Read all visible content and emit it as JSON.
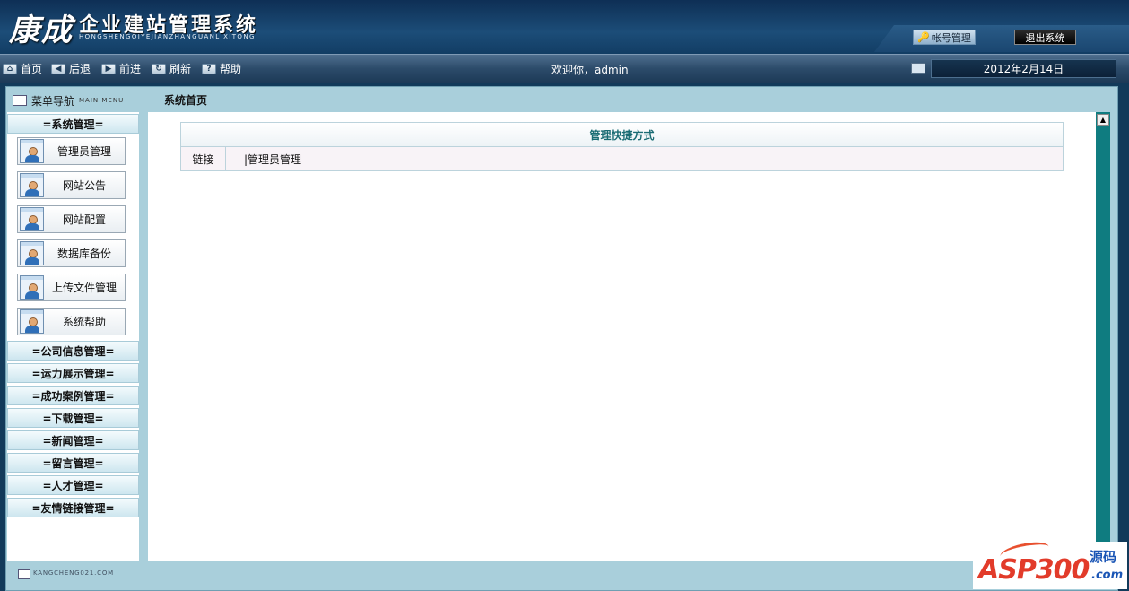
{
  "header": {
    "logo_main": "康成",
    "logo_title": "企业建站管理系统",
    "logo_sub": "HONGSHENGQIYEJIANZHANGUANLIXITONG",
    "account_button": "帐号管理",
    "logout_button": "退出系统"
  },
  "toolbar": {
    "items": [
      {
        "label": "首页",
        "icon": "home-icon"
      },
      {
        "label": "后退",
        "icon": "back-icon"
      },
      {
        "label": "前进",
        "icon": "forward-icon"
      },
      {
        "label": "刷新",
        "icon": "refresh-icon"
      },
      {
        "label": "帮助",
        "icon": "help-icon"
      }
    ],
    "welcome": "欢迎你，admin",
    "date": "2012年2月14日"
  },
  "menu": {
    "title": "菜单导航",
    "title_en": "MAIN MENU",
    "categories": [
      {
        "label": "=系统管理="
      },
      {
        "label": "=公司信息管理="
      },
      {
        "label": "=运力展示管理="
      },
      {
        "label": "=成功案例管理="
      },
      {
        "label": "=下载管理="
      },
      {
        "label": "=新闻管理="
      },
      {
        "label": "=留言管理="
      },
      {
        "label": "=人才管理="
      },
      {
        "label": "=友情链接管理="
      }
    ],
    "sub_items": [
      {
        "label": "管理员管理"
      },
      {
        "label": "网站公告"
      },
      {
        "label": "网站配置"
      },
      {
        "label": "数据库备份"
      },
      {
        "label": "上传文件管理"
      },
      {
        "label": "系统帮助"
      }
    ]
  },
  "page_title": "系统首页",
  "shortcuts": {
    "title": "管理快捷方式",
    "row_label": "链接",
    "link_text": "|管理员管理"
  },
  "footer": {
    "text": "KANGCHENG021.COM"
  },
  "watermark": {
    "main": "ASP300",
    "cn": "源码",
    "com": ".com"
  }
}
